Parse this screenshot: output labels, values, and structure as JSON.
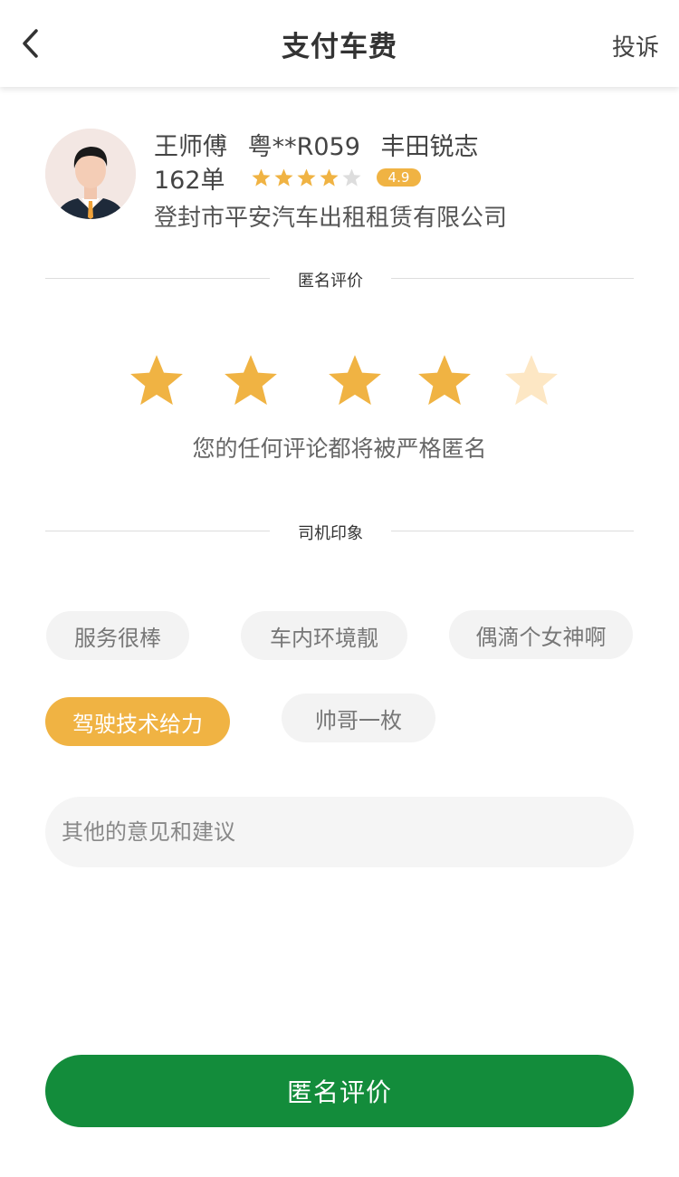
{
  "header": {
    "title": "支付车费",
    "complaint_label": "投诉",
    "back_icon": "chevron-left-icon"
  },
  "driver": {
    "name": "王师傅",
    "plate": "粤**R059",
    "car_model": "丰田锐志",
    "orders": "162单",
    "rating_stars": 4,
    "rating_value": "4.9",
    "company": "登封市平安汽车出租租赁有限公司"
  },
  "rating_section": {
    "title": "匿名评价",
    "stars_selected": 4,
    "stars_total": 5,
    "note": "您的任何评论都将被严格匿名"
  },
  "impression_section": {
    "title": "司机印象",
    "tags": [
      {
        "label": "服务很棒",
        "selected": false
      },
      {
        "label": "车内环境靓",
        "selected": false
      },
      {
        "label": "偶滴个女神啊",
        "selected": false
      },
      {
        "label": "驾驶技术给力",
        "selected": true
      },
      {
        "label": "帅哥一枚",
        "selected": false
      }
    ]
  },
  "suggestion": {
    "placeholder": "其他的意见和建议",
    "value": ""
  },
  "submit_label": "匿名评价",
  "colors": {
    "accent": "#f0b343",
    "star_empty": "#fde7c4",
    "primary_button": "#138c3b",
    "mini_star_empty": "#dddddd"
  }
}
